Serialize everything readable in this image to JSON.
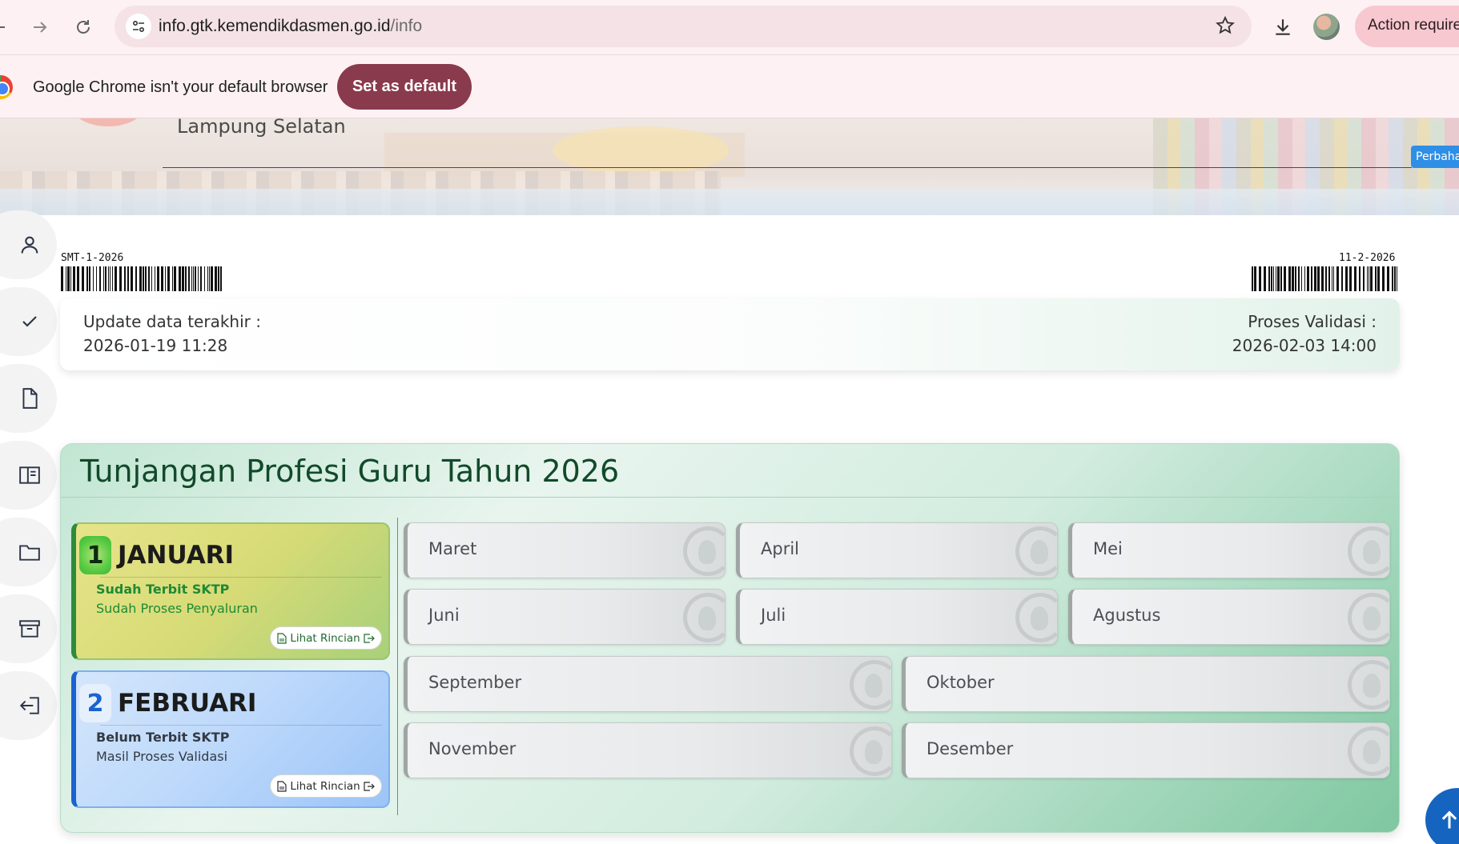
{
  "browser": {
    "url_domain": "info.gtk.kemendikdasmen.go.id",
    "url_path": "/info",
    "action_label": "Action required",
    "infobar_text": "Google Chrome isn't your default browser",
    "set_default_label": "Set as default"
  },
  "header": {
    "region": "Lampung Selatan",
    "update_tag": "Perbaharui"
  },
  "sidebar": {
    "items": [
      {
        "icon": "user-icon"
      },
      {
        "icon": "check-icon"
      },
      {
        "icon": "document-icon"
      },
      {
        "icon": "book-icon"
      },
      {
        "icon": "folder-icon"
      },
      {
        "icon": "archive-icon"
      },
      {
        "icon": "logout-icon"
      }
    ]
  },
  "barcodes": {
    "left_code": "SMT-1-2026",
    "right_code": "11-2-2026"
  },
  "update": {
    "last_update_label": "Update data terakhir :",
    "last_update_value": "2026-01-19 11:28",
    "validation_label": "Proses Validasi :",
    "validation_value": "2026-02-03 14:00"
  },
  "tpg": {
    "title": "Tunjangan Profesi Guru Tahun 2026",
    "active_months": [
      {
        "number": "1",
        "name": "JANUARI",
        "status1": "Sudah Terbit SKTP",
        "status2": "Sudah Proses Penyaluran",
        "button": "Lihat Rincian",
        "accent": "#2e8b3a"
      },
      {
        "number": "2",
        "name": "FEBRUARI",
        "status1": "Belum Terbit SKTP",
        "status2": "Masil Proses Validasi",
        "button": "Lihat Rincian",
        "accent": "#1a63d0"
      }
    ],
    "months": [
      "Maret",
      "April",
      "Mei",
      "Juni",
      "Juli",
      "Agustus",
      "September",
      "Oktober",
      "November",
      "Desember"
    ]
  },
  "scroll_top_icon": "arrow-up-icon"
}
